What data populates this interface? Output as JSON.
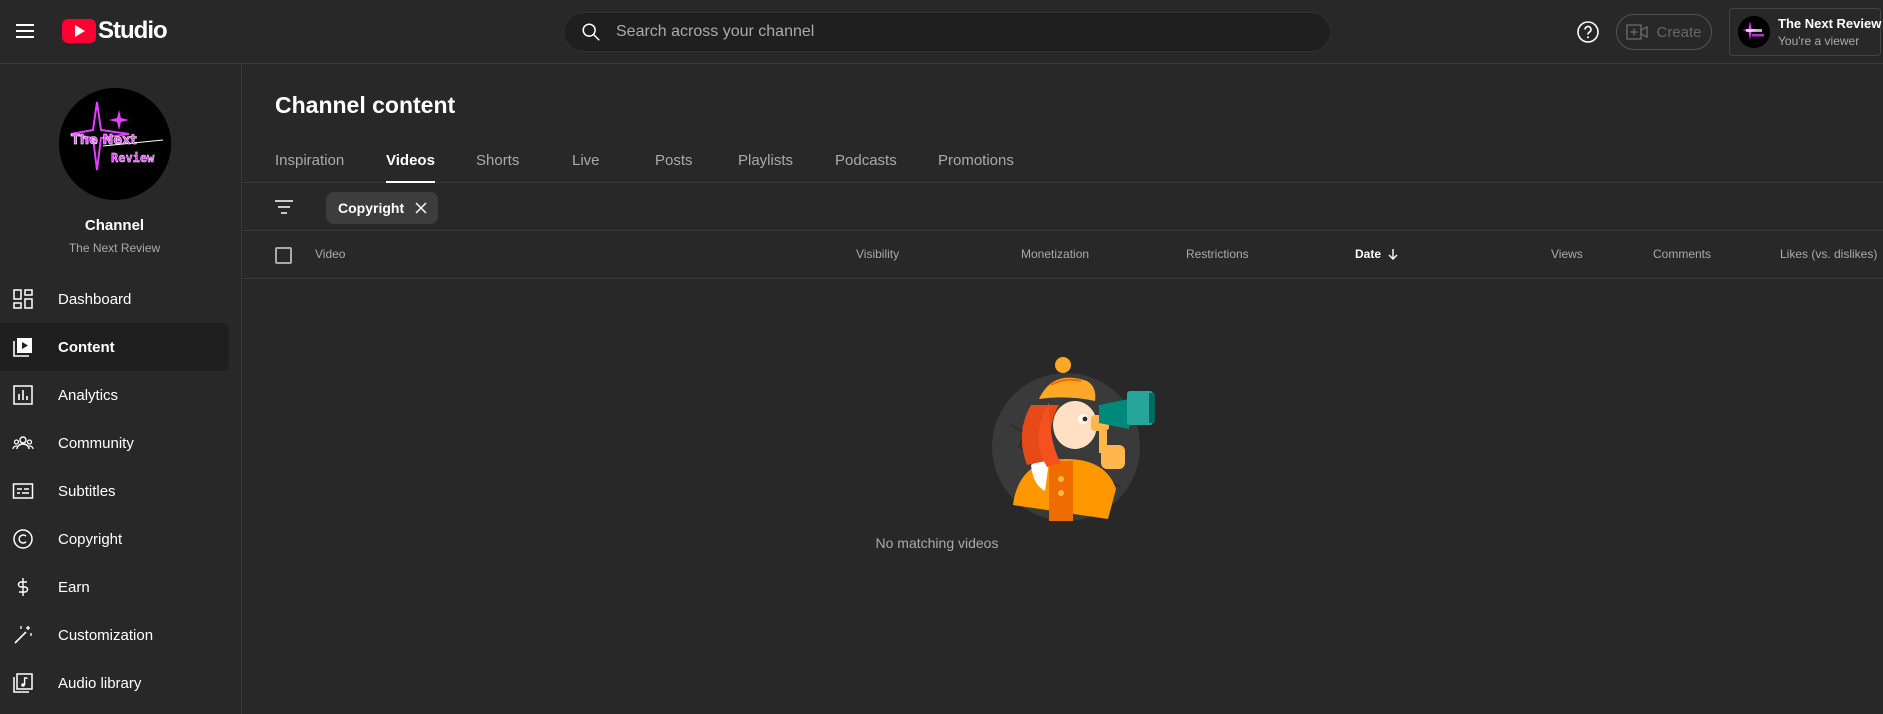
{
  "header": {
    "logo_text": "Studio",
    "search_placeholder": "Search across your channel",
    "create_label": "Create",
    "account_name": "The Next Review",
    "account_role": "You're a viewer"
  },
  "sidebar": {
    "channel_label": "Channel",
    "channel_name": "The Next Review",
    "avatar_text_1": "The Next",
    "avatar_text_2": "Review",
    "items": [
      {
        "label": "Dashboard",
        "icon": "dashboard-icon"
      },
      {
        "label": "Content",
        "icon": "content-icon",
        "active": true
      },
      {
        "label": "Analytics",
        "icon": "analytics-icon"
      },
      {
        "label": "Community",
        "icon": "community-icon"
      },
      {
        "label": "Subtitles",
        "icon": "subtitles-icon"
      },
      {
        "label": "Copyright",
        "icon": "copyright-icon"
      },
      {
        "label": "Earn",
        "icon": "dollar-icon"
      },
      {
        "label": "Customization",
        "icon": "magic-wand-icon"
      },
      {
        "label": "Audio library",
        "icon": "audio-library-icon"
      }
    ]
  },
  "main": {
    "title": "Channel content",
    "tabs": [
      {
        "label": "Inspiration"
      },
      {
        "label": "Videos",
        "active": true
      },
      {
        "label": "Shorts"
      },
      {
        "label": "Live"
      },
      {
        "label": "Posts"
      },
      {
        "label": "Playlists"
      },
      {
        "label": "Podcasts"
      },
      {
        "label": "Promotions"
      }
    ],
    "filter_chip": "Copyright",
    "columns": {
      "video": "Video",
      "visibility": "Visibility",
      "monetization": "Monetization",
      "restrictions": "Restrictions",
      "date": "Date",
      "views": "Views",
      "comments": "Comments",
      "likes": "Likes (vs. dislikes)"
    },
    "empty_message": "No matching videos"
  },
  "colors": {
    "background": "#282828",
    "brand_red": "#ff0033",
    "accent_pink": "#e040fb"
  }
}
